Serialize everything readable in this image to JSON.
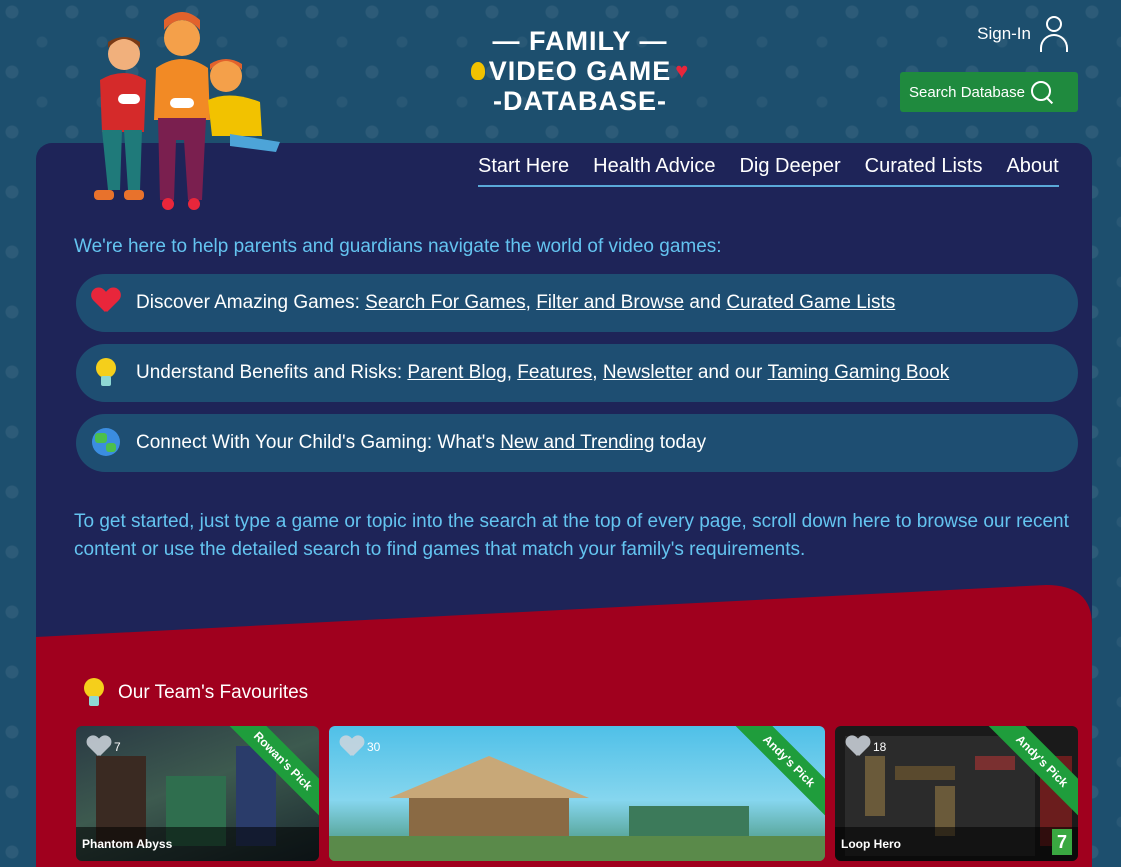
{
  "logo": {
    "line1": "— FAMILY —",
    "line2": "VIDEO GAME",
    "line3": "-DATABASE-"
  },
  "header": {
    "signin_label": "Sign-In",
    "search_label": "Search Database"
  },
  "nav": {
    "items": [
      "Start Here",
      "Health Advice",
      "Dig Deeper",
      "Curated Lists",
      "About"
    ]
  },
  "intro": "We're here to help parents and guardians navigate the world of video games:",
  "rows": [
    {
      "prefix": "Discover Amazing Games: ",
      "link1": "Search For Games",
      "sep1": ", ",
      "link2": "Filter and Browse",
      "sep2": " and ",
      "link3": "Curated Game Lists",
      "icon": "heart-icon"
    },
    {
      "prefix": "Understand Benefits and Risks: ",
      "link1": "Parent Blog",
      "sep1": ", ",
      "link2": "Features",
      "sep2": ", ",
      "link3": "Newsletter",
      "sep3": " and our ",
      "link4": "Taming Gaming Book",
      "icon": "lightbulb-icon"
    },
    {
      "prefix": "Connect With Your Child's Gaming: What's ",
      "link1": "New and Trending",
      "suffix": " today",
      "icon": "globe-icon"
    }
  ],
  "getstarted": "To get started, just type a game or topic into the search at the top of every page, scroll down here to browse our recent content or use the detailed search to find games that match your family's requirements.",
  "favourites": {
    "title": "Our Team's Favourites",
    "cards": [
      {
        "name": "Phantom Abyss",
        "likes": "7",
        "ribbon": "Rowan's Pick"
      },
      {
        "name": "",
        "likes": "30",
        "ribbon": "Andy's Pick"
      },
      {
        "name": "Loop Hero",
        "likes": "18",
        "ribbon": "Andy's Pick",
        "rating": "7"
      }
    ]
  },
  "colors": {
    "background": "#1d4f6e",
    "panel": "#1e2458",
    "accent_text": "#64c4f0",
    "row_bg": "#1e4e72",
    "green": "#1f8a3e",
    "red_section": "#a0001e",
    "heart": "#e8263b"
  }
}
